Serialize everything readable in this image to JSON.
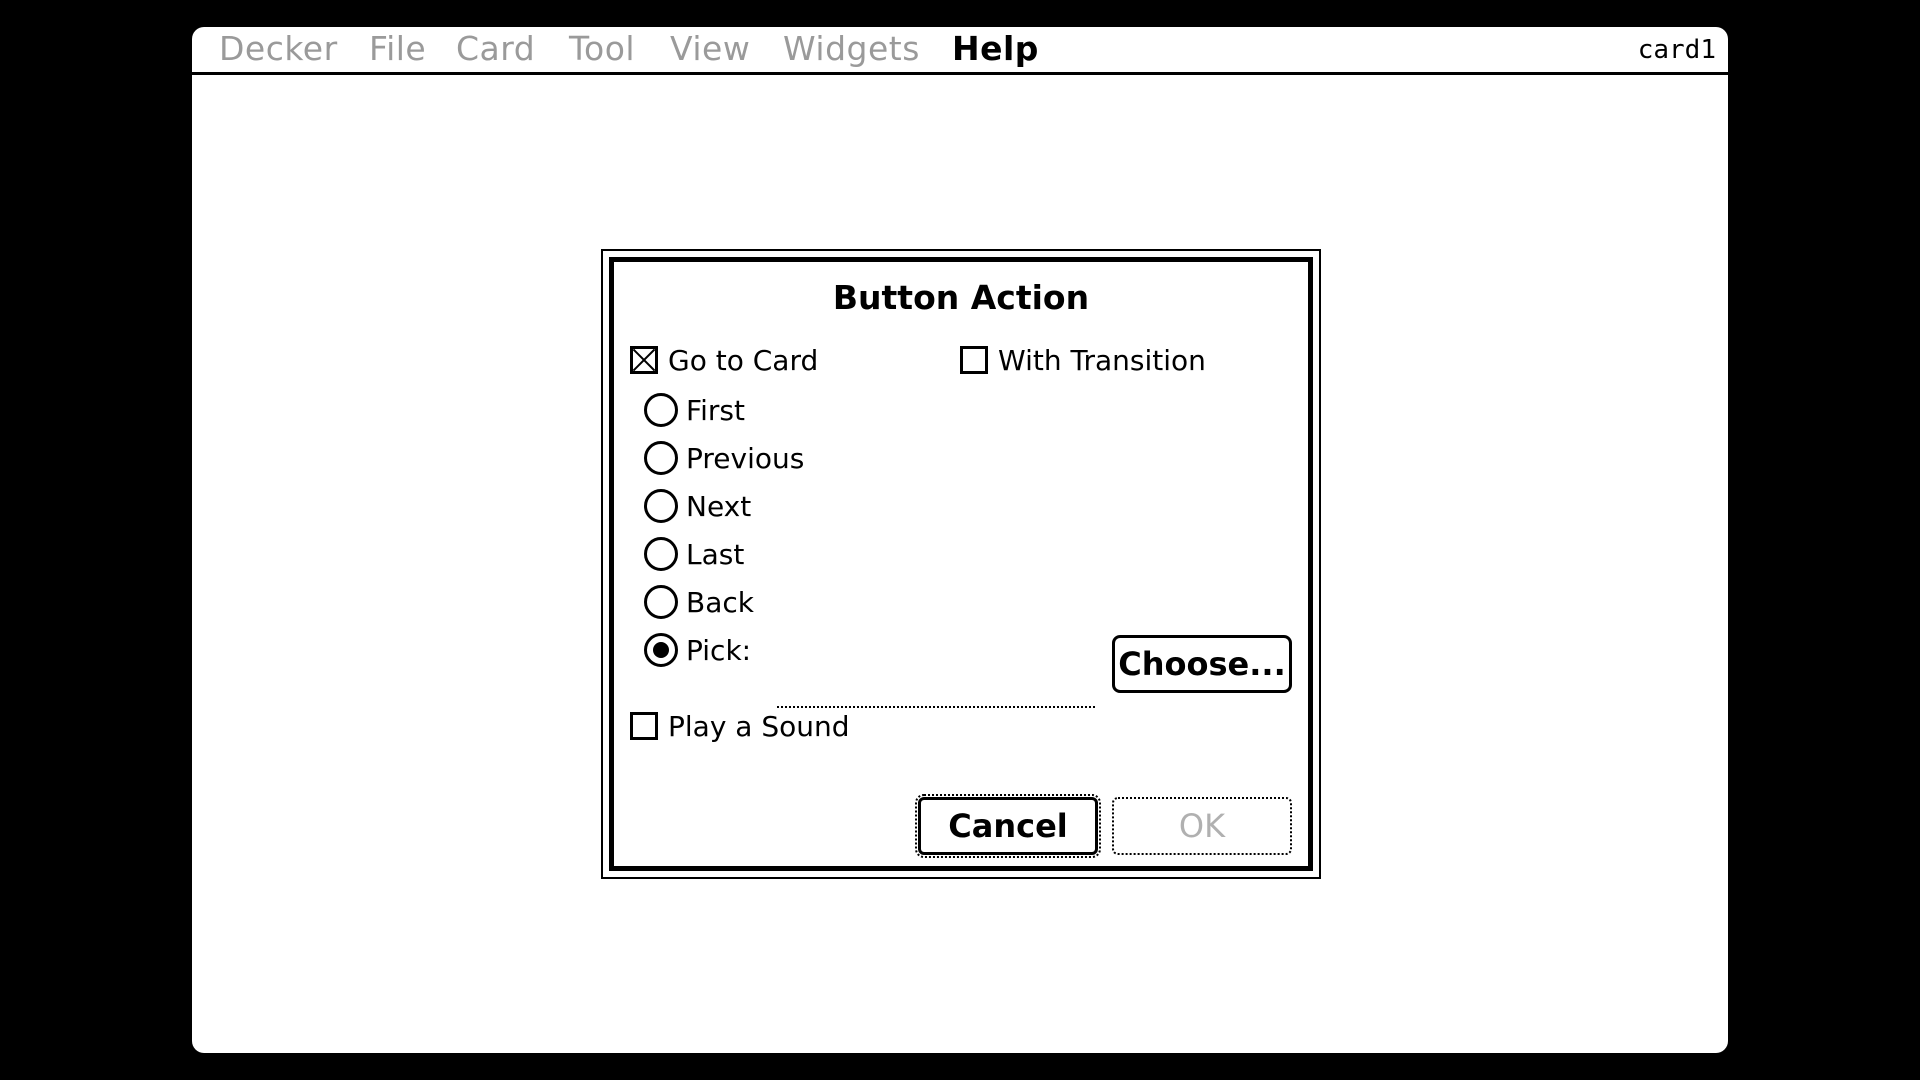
{
  "menubar": {
    "items": [
      {
        "label": "Decker",
        "state": "disabled"
      },
      {
        "label": "File",
        "state": "disabled"
      },
      {
        "label": "Card",
        "state": "disabled"
      },
      {
        "label": "Tool",
        "state": "disabled"
      },
      {
        "label": "View",
        "state": "disabled"
      },
      {
        "label": "Widgets",
        "state": "disabled"
      },
      {
        "label": "Help",
        "state": "active"
      }
    ],
    "card_name": "card1"
  },
  "dialog": {
    "title": "Button Action",
    "go_to_card": {
      "label": "Go to Card",
      "checked": true
    },
    "with_transition": {
      "label": "With Transition",
      "checked": false
    },
    "destinations": [
      {
        "label": "First",
        "selected": false
      },
      {
        "label": "Previous",
        "selected": false
      },
      {
        "label": "Next",
        "selected": false
      },
      {
        "label": "Last",
        "selected": false
      },
      {
        "label": "Back",
        "selected": false
      },
      {
        "label": "Pick:",
        "selected": true
      }
    ],
    "pick_value": "",
    "choose_label": "Choose...",
    "play_sound": {
      "label": "Play a Sound",
      "checked": false
    },
    "cancel_label": "Cancel",
    "ok_label": "OK",
    "ok_enabled": false
  },
  "colors": {
    "background": "#000000",
    "screen": "#ffffff",
    "disabled_text": "#9a9a9a"
  }
}
